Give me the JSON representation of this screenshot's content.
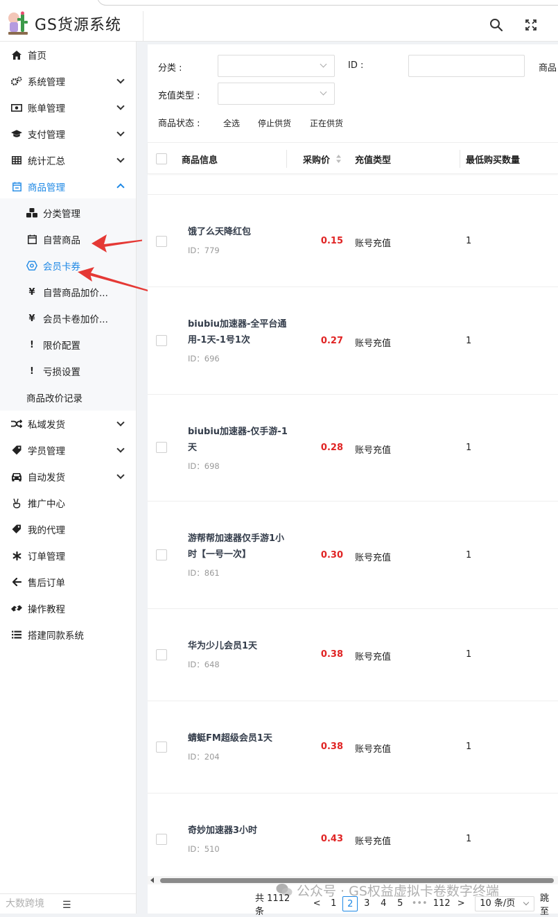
{
  "app": {
    "title": "GS货源系统"
  },
  "colors": {
    "accent": "#1e88e5",
    "price": "#e02424",
    "arrow": "#e53935"
  },
  "sidebar": {
    "items": [
      {
        "label": "首页",
        "icon": "home-icon"
      },
      {
        "label": "系统管理",
        "icon": "cogs-icon"
      },
      {
        "label": "账单管理",
        "icon": "money-icon"
      },
      {
        "label": "支付管理",
        "icon": "graduation-cap-icon"
      },
      {
        "label": "统计汇总",
        "icon": "table-icon"
      },
      {
        "label": "商品管理",
        "icon": "calendar-minus-icon"
      },
      {
        "label": "私域发货",
        "icon": "random-icon"
      },
      {
        "label": "学员管理",
        "icon": "tag-icon"
      },
      {
        "label": "自动发货",
        "icon": "car-icon"
      },
      {
        "label": "推广中心",
        "icon": "peace-hand-icon"
      },
      {
        "label": "我的代理",
        "icon": "tags-icon"
      },
      {
        "label": "订单管理",
        "icon": "asterisk-icon"
      },
      {
        "label": "售后订单",
        "icon": "arrow-left-icon"
      },
      {
        "label": "操作教程",
        "icon": "hands-icon"
      },
      {
        "label": "搭建同款系统",
        "icon": "list-icon"
      }
    ],
    "sub_items": [
      {
        "label": "分类管理",
        "icon": "cubes-icon"
      },
      {
        "label": "自营商品",
        "icon": "calendar-icon"
      },
      {
        "label": "会员卡券",
        "icon": "octagon-icon"
      },
      {
        "label": "自营商品加价...",
        "icon": "yen-icon"
      },
      {
        "label": "会员卡卷加价...",
        "icon": "yen-icon"
      },
      {
        "label": "限价配置",
        "icon": "exclamation-icon"
      },
      {
        "label": "亏损设置",
        "icon": "exclamation-icon"
      },
      {
        "label": "商品改价记录",
        "icon": ""
      }
    ],
    "glyphs": {
      "yen": "¥",
      "exclaim": "!"
    }
  },
  "filters": {
    "category_label": "分类 :",
    "id_label": "ID :",
    "product_label": "商品",
    "recharge_type_label": "充值类型 :",
    "status_label": "商品状态 :",
    "status_options": [
      "全选",
      "停止供货",
      "正在供货"
    ]
  },
  "table": {
    "headers": [
      "商品信息",
      "采购价",
      "充值类型",
      "最低购买数量"
    ],
    "rows": [
      {
        "name": "饿了么天降红包",
        "id": "ID：779",
        "price": "0.15",
        "type": "账号充值",
        "min_qty": "1"
      },
      {
        "name": "biubiu加速器-全平台通用-1天-1号1次",
        "id": "ID：696",
        "price": "0.27",
        "type": "账号充值",
        "min_qty": "1"
      },
      {
        "name": "biubiu加速器-仅手游-1天",
        "id": "ID：698",
        "price": "0.28",
        "type": "账号充值",
        "min_qty": "1"
      },
      {
        "name": "游帮帮加速器仅手游1小时【一号一次】",
        "id": "ID：861",
        "price": "0.30",
        "type": "账号充值",
        "min_qty": "1"
      },
      {
        "name": "华为少儿会员1天",
        "id": "ID：648",
        "price": "0.38",
        "type": "账号充值",
        "min_qty": "1"
      },
      {
        "name": "蜻蜓FM超级会员1天",
        "id": "ID：204",
        "price": "0.38",
        "type": "账号充值",
        "min_qty": "1"
      },
      {
        "name": "奇妙加速器3小时",
        "id": "ID：510",
        "price": "0.43",
        "type": "账号充值",
        "min_qty": "1"
      }
    ]
  },
  "pagination": {
    "total": "共 1112 条",
    "pages": [
      "1",
      "2",
      "3",
      "4",
      "5",
      "•••",
      "112"
    ],
    "current": "2",
    "page_size": "10 条/页",
    "jump_label": "跳至",
    "prev": "<",
    "next": ">"
  },
  "watermark": {
    "text": "公众号 · GS权益虚拟卡卷数字终端",
    "corner": "大数跨境"
  },
  "misc": {
    "footer_glyph": "☰"
  }
}
